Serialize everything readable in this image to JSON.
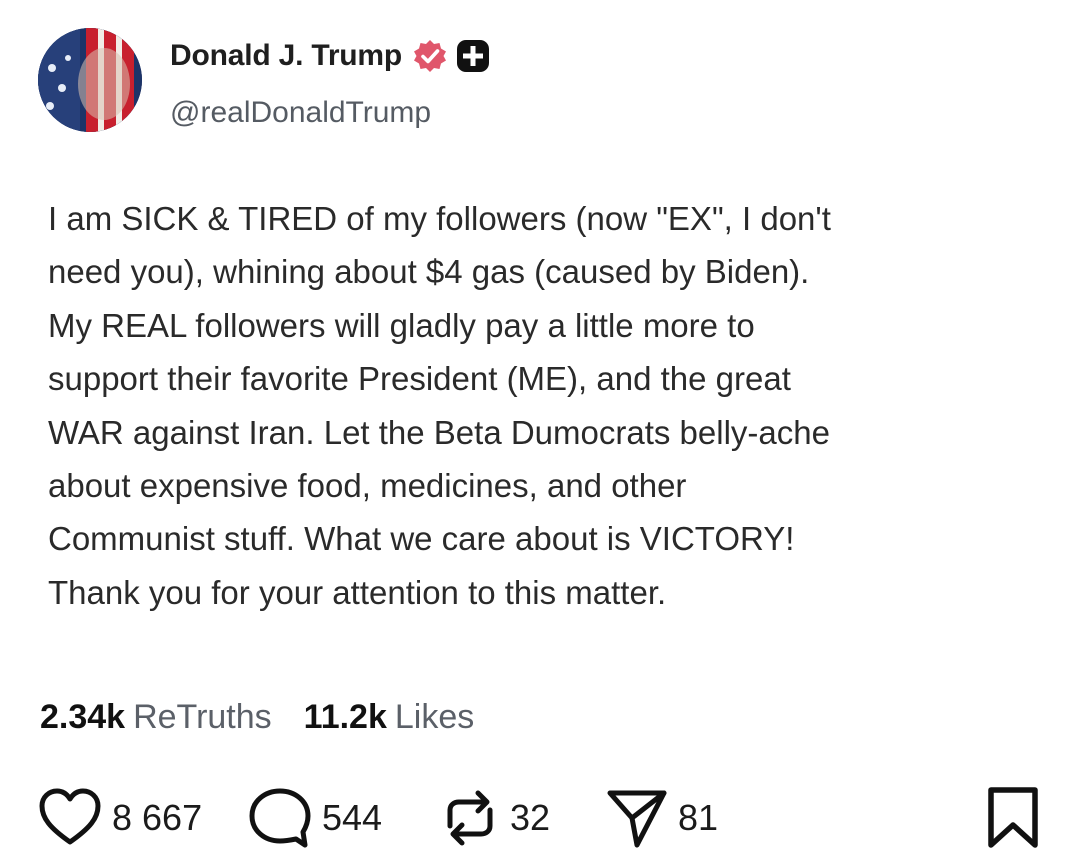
{
  "post": {
    "author": {
      "display_name": "Donald J. Trump",
      "handle": "@realDonaldTrump",
      "verified_icon": "verified-badge-icon",
      "follow_icon": "plus-icon"
    },
    "text_lines": [
      "I am SICK & TIRED of my followers (now \"EX\", I don't",
      "need you), whining about $4 gas (caused by Biden).",
      "My REAL followers will gladly pay a little more to",
      "support their favorite President (ME), and the great",
      "WAR against Iran. Let the Beta Dumocrats belly-ache",
      "about expensive food, medicines, and other",
      "Communist stuff. What we care about is VICTORY!",
      "Thank you for your attention to this matter."
    ],
    "stats": {
      "retruths_count": "2.34k",
      "retruths_label": "ReTruths",
      "likes_count": "11.2k",
      "likes_label": "Likes"
    },
    "actions": {
      "like_count": "8 667",
      "reply_count": "544",
      "retruth_count": "32",
      "share_count": "81",
      "like_icon": "heart-icon",
      "reply_icon": "speech-bubble-icon",
      "retruth_icon": "repost-icon",
      "share_icon": "paper-plane-icon",
      "bookmark_icon": "bookmark-icon"
    }
  },
  "colors": {
    "verified": "#e0566b",
    "text": "#2a2a2a",
    "muted": "#5b6068"
  }
}
